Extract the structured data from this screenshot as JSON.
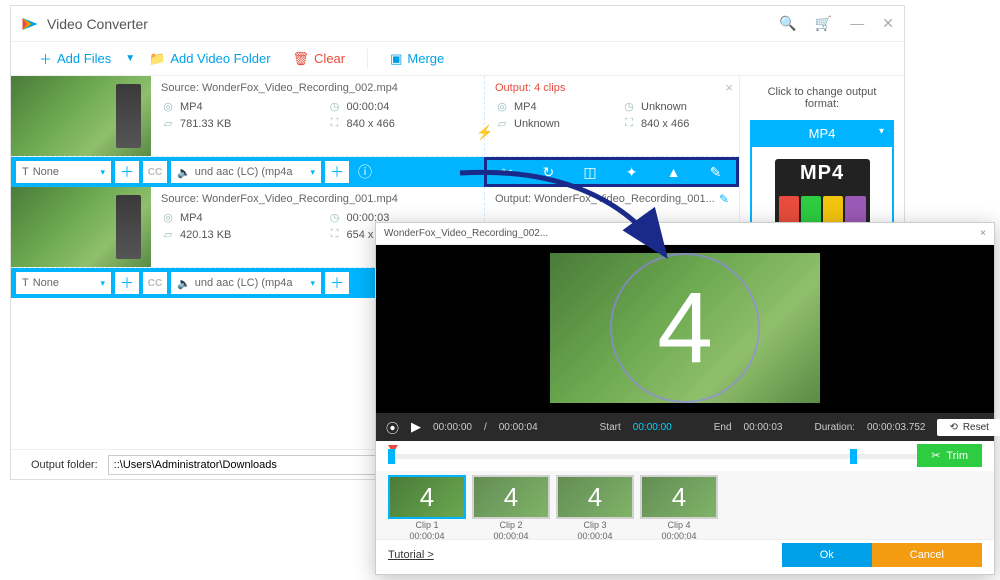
{
  "app": {
    "title": "Video Converter"
  },
  "toolbar": {
    "add_files": "Add Files",
    "add_folder": "Add Video Folder",
    "clear": "Clear",
    "merge": "Merge"
  },
  "files": [
    {
      "source": "Source: WonderFox_Video_Recording_002.mp4",
      "fmt": "MP4",
      "dur": "00:00:04",
      "size": "781.33 KB",
      "res": "840 x 466",
      "out_title": "Output: 4 clips",
      "out_fmt": "MP4",
      "out_dur": "Unknown",
      "out_size": "Unknown",
      "out_res": "840 x 466",
      "subtitle": "None",
      "audio": "und aac (LC) (mp4a"
    },
    {
      "source": "Source: WonderFox_Video_Recording_001.mp4",
      "fmt": "MP4",
      "dur": "00:00:03",
      "size": "420.13 KB",
      "res": "654 x 552",
      "out_title": "Output: WonderFox_Video_Recording_001...",
      "subtitle": "None",
      "audio": "und aac (LC) (mp4a"
    }
  ],
  "output_format": {
    "hint": "Click to change output format:",
    "label": "MP4",
    "tile": "MP4"
  },
  "footer": {
    "label": "Output folder:",
    "path": "::\\Users\\Administrator\\Downloads"
  },
  "editor": {
    "title": "WonderFox_Video_Recording_002...",
    "countdown": "4",
    "time_cur": "00:00:00",
    "time_tot": "00:00:04",
    "start_lbl": "Start",
    "start_val": "00:00:00",
    "end_lbl": "End",
    "end_val": "00:00:03",
    "dur_lbl": "Duration:",
    "dur_val": "00:00:03.752",
    "reset": "Reset",
    "trim": "Trim",
    "clips": [
      {
        "name": "Clip 1",
        "dur": "00:00:04"
      },
      {
        "name": "Clip 2",
        "dur": "00:00:04"
      },
      {
        "name": "Clip 3",
        "dur": "00:00:04"
      },
      {
        "name": "Clip 4",
        "dur": "00:00:04"
      }
    ],
    "tutorial": "Tutorial >",
    "ok": "Ok",
    "cancel": "Cancel"
  }
}
